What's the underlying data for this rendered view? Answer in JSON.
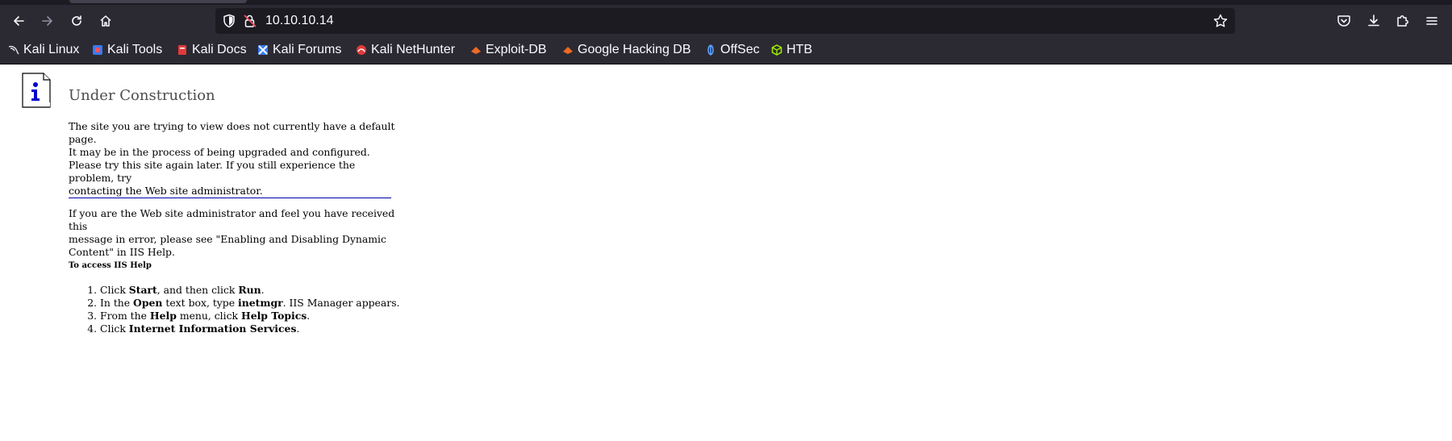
{
  "browser": {
    "url": "10.10.10.14",
    "bookmarks": [
      {
        "label": "Kali Linux",
        "icon": "kali-dragon-icon"
      },
      {
        "label": "Kali Tools",
        "icon": "kali-tools-icon"
      },
      {
        "label": "Kali Docs",
        "icon": "kali-docs-icon"
      },
      {
        "label": "Kali Forums",
        "icon": "kali-forums-icon"
      },
      {
        "label": "Kali NetHunter",
        "icon": "kali-nethunter-icon"
      },
      {
        "label": "Exploit-DB",
        "icon": "exploit-db-icon"
      },
      {
        "label": "Google Hacking DB",
        "icon": "ghdb-icon"
      },
      {
        "label": "OffSec",
        "icon": "offsec-icon"
      },
      {
        "label": "HTB",
        "icon": "htb-icon"
      }
    ],
    "colors": {
      "chrome_bg": "#2b2a33",
      "urlbar_bg": "#1c1b22",
      "text": "#fbfbfe"
    }
  },
  "page": {
    "heading": "Under Construction",
    "para1_line1": "The site you are trying to view does not currently have a default page.",
    "para1_line2": "It may be in the process of being upgraded and configured.",
    "para2_line1": "Please try this site again later. If you still experience the problem, try",
    "para2_line2": "contacting the Web site administrator.",
    "para3_line1": "If you are the Web site administrator and feel you have received this",
    "para3_line2": "message in error, please see \"Enabling and Disabling Dynamic",
    "para3_line3": "Content\" in IIS Help.",
    "help_title": "To access IIS Help",
    "steps": {
      "s1": {
        "pre": "Click ",
        "b1": "Start",
        "mid": ", and then click ",
        "b2": "Run",
        "post": "."
      },
      "s2": {
        "pre": "In the ",
        "b1": "Open",
        "mid": " text box, type ",
        "b2": "inetmgr",
        "post": ". IIS Manager appears."
      },
      "s3": {
        "pre": "From the ",
        "b1": "Help",
        "mid": " menu, click ",
        "b2": "Help Topics",
        "post": "."
      },
      "s4": {
        "pre": "Click ",
        "b1": "Internet Information Services",
        "post": "."
      }
    }
  }
}
